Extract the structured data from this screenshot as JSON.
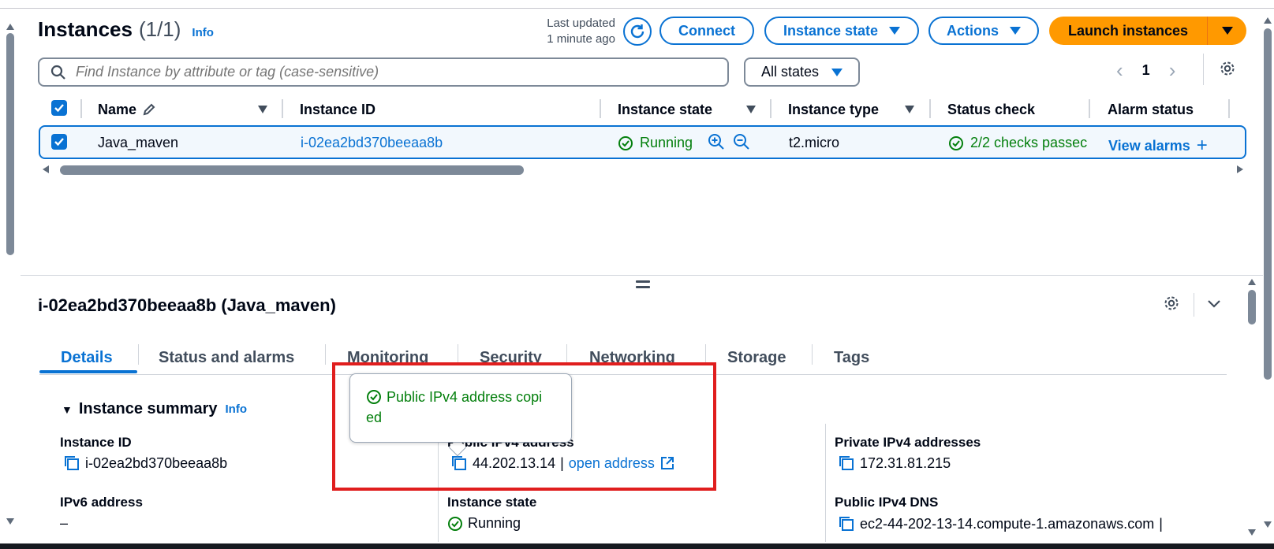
{
  "header": {
    "title": "Instances",
    "count": "(1/1)",
    "info": "Info",
    "last_updated_line1": "Last updated",
    "last_updated_line2": "1 minute ago",
    "connect": "Connect",
    "instance_state": "Instance state",
    "actions": "Actions",
    "launch": "Launch instances"
  },
  "search": {
    "placeholder": "Find Instance by attribute or tag (case-sensitive)"
  },
  "filter": {
    "states": "All states"
  },
  "pager": {
    "page": "1"
  },
  "table": {
    "columns": [
      "Name",
      "Instance ID",
      "Instance state",
      "Instance type",
      "Status check",
      "Alarm status"
    ],
    "row": {
      "name": "Java_maven",
      "instance_id": "i-02ea2bd370beeaa8b",
      "state": "Running",
      "type": "t2.micro",
      "status_check": "2/2 checks passec",
      "alarm": "View alarms"
    }
  },
  "details": {
    "title": "i-02ea2bd370beeaa8b (Java_maven)",
    "tabs": [
      "Details",
      "Status and alarms",
      "Monitoring",
      "Security",
      "Networking",
      "Storage",
      "Tags"
    ],
    "summary_title": "Instance summary",
    "summary_info": "Info",
    "instance_id_label": "Instance ID",
    "instance_id_value": "i-02ea2bd370beeaa8b",
    "ipv6_label": "IPv6 address",
    "ipv6_value": "–",
    "public_ip_label": "Public IPv4 address",
    "public_ip_value": "44.202.13.14",
    "open_address": "open address",
    "state_label": "Instance state",
    "state_value": "Running",
    "private_ip_label": "Private IPv4 addresses",
    "private_ip_value": "172.31.81.215",
    "public_dns_label": "Public IPv4 DNS",
    "public_dns_value": "ec2-44-202-13-14.compute-1.amazonaws.com",
    "pipe": "|"
  },
  "tooltip": {
    "line1": "Public IPv4 address copi",
    "line2": "ed"
  },
  "colors": {
    "accent": "#0972d3",
    "success": "#037f0c",
    "launch": "#ff9900",
    "highlight": "#e01e1e"
  }
}
